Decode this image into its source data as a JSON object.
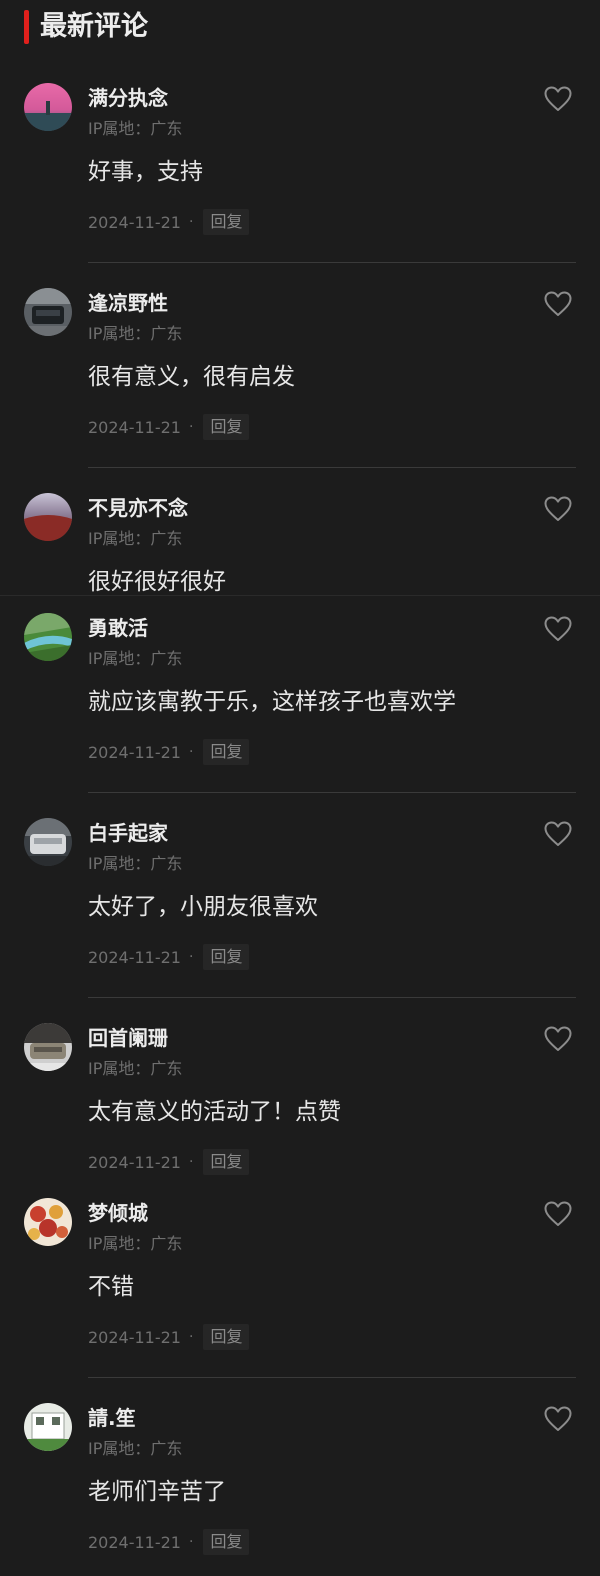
{
  "header": {
    "title": "最新评论"
  },
  "colors": {
    "accent": "#e0201c",
    "background": "#1c1c1c",
    "secondary_text": "#6f6f6f"
  },
  "comments": [
    {
      "username": "满分执念",
      "ip": "IP属地：广东",
      "content": "好事，支持",
      "date": "2024-11-21",
      "reply": "回复",
      "like_icon": "heart-outline-icon"
    },
    {
      "username": "逢凉野性",
      "ip": "IP属地：广东",
      "content": "很有意义，很有启发",
      "date": "2024-11-21",
      "reply": "回复",
      "like_icon": "heart-outline-icon"
    },
    {
      "username": "不見亦不念",
      "ip": "IP属地：广东",
      "content": "很好很好很好",
      "like_icon": "heart-outline-icon"
    },
    {
      "username": "勇敢活",
      "ip": "IP属地：广东",
      "content": "就应该寓教于乐，这样孩子也喜欢学",
      "date": "2024-11-21",
      "reply": "回复",
      "like_icon": "heart-outline-icon"
    },
    {
      "username": "白手起家",
      "ip": "IP属地：广东",
      "content": "太好了，小朋友很喜欢",
      "date": "2024-11-21",
      "reply": "回复",
      "like_icon": "heart-outline-icon"
    },
    {
      "username": "回首阑珊",
      "ip": "IP属地：广东",
      "content": "太有意义的活动了！点赞",
      "date": "2024-11-21",
      "reply": "回复",
      "like_icon": "heart-outline-icon"
    },
    {
      "username": "梦倾城",
      "ip": "IP属地：广东",
      "content": "不错",
      "date": "2024-11-21",
      "reply": "回复",
      "like_icon": "heart-outline-icon"
    },
    {
      "username": "請.笙",
      "ip": "IP属地：广东",
      "content": "老师们辛苦了",
      "date": "2024-11-21",
      "reply": "回复",
      "like_icon": "heart-outline-icon"
    }
  ]
}
